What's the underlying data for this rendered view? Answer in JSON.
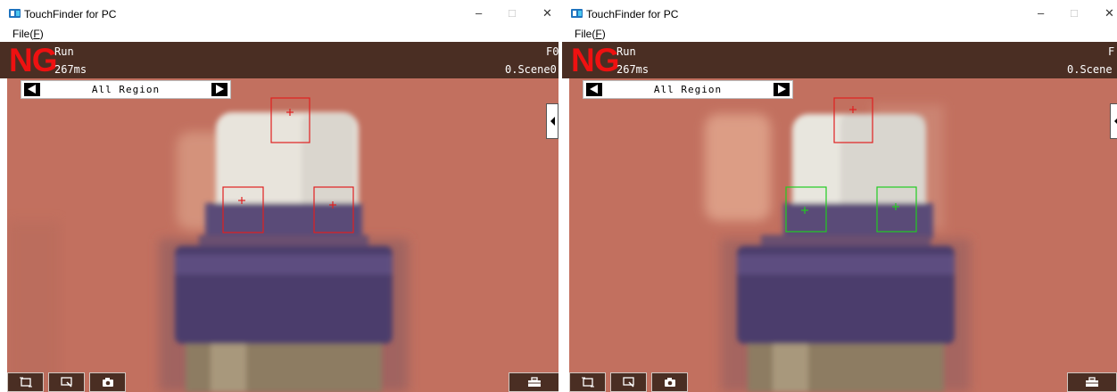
{
  "windows": [
    {
      "title": "TouchFinder for PC",
      "menu": {
        "file_text": "File(",
        "file_key": "F",
        "file_close": ")"
      },
      "status": {
        "result": "NG",
        "mode": "Run",
        "time": "267ms",
        "right_top": "F0",
        "right_bottom": "0.Scene0"
      },
      "region": {
        "label": "All Region"
      },
      "windows_controls": {
        "minimize": "–",
        "maximize": "□",
        "close": "✕"
      },
      "regions_color": "#e02020",
      "icons": [
        "zoom-fit-icon",
        "zoom-region-icon",
        "camera-icon",
        "toolbox-icon"
      ]
    },
    {
      "title": "TouchFinder for PC",
      "menu": {
        "file_text": "File(",
        "file_key": "F",
        "file_close": ")"
      },
      "status": {
        "result": "NG",
        "mode": "Run",
        "time": "267ms",
        "right_top": "F",
        "right_bottom": "0.Scene"
      },
      "region": {
        "label": "All Region"
      },
      "windows_controls": {
        "minimize": "–",
        "maximize": "□",
        "close": "✕"
      },
      "regions_color": "#22cc22",
      "icons": [
        "zoom-fit-icon",
        "zoom-region-icon",
        "camera-icon",
        "toolbox-icon"
      ]
    }
  ],
  "colors": {
    "ng_red": "#ee1111",
    "status_bg": "#4a2e23",
    "view_bg": "#c2705f",
    "ng_region": "#e02020",
    "ok_region": "#22cc22"
  }
}
